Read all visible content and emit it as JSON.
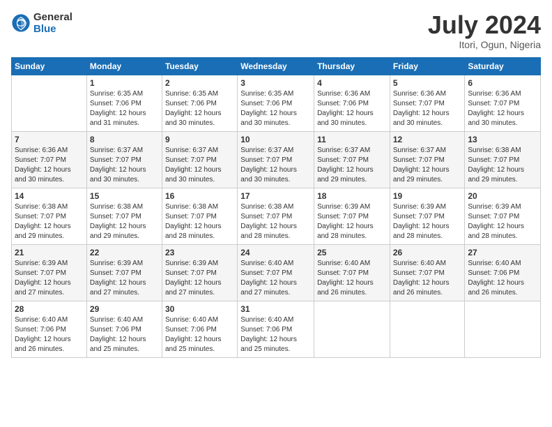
{
  "header": {
    "logo_general": "General",
    "logo_blue": "Blue",
    "month_title": "July 2024",
    "location": "Itori, Ogun, Nigeria"
  },
  "weekdays": [
    "Sunday",
    "Monday",
    "Tuesday",
    "Wednesday",
    "Thursday",
    "Friday",
    "Saturday"
  ],
  "weeks": [
    [
      {
        "day": "",
        "info": ""
      },
      {
        "day": "1",
        "info": "Sunrise: 6:35 AM\nSunset: 7:06 PM\nDaylight: 12 hours\nand 31 minutes."
      },
      {
        "day": "2",
        "info": "Sunrise: 6:35 AM\nSunset: 7:06 PM\nDaylight: 12 hours\nand 30 minutes."
      },
      {
        "day": "3",
        "info": "Sunrise: 6:35 AM\nSunset: 7:06 PM\nDaylight: 12 hours\nand 30 minutes."
      },
      {
        "day": "4",
        "info": "Sunrise: 6:36 AM\nSunset: 7:06 PM\nDaylight: 12 hours\nand 30 minutes."
      },
      {
        "day": "5",
        "info": "Sunrise: 6:36 AM\nSunset: 7:07 PM\nDaylight: 12 hours\nand 30 minutes."
      },
      {
        "day": "6",
        "info": "Sunrise: 6:36 AM\nSunset: 7:07 PM\nDaylight: 12 hours\nand 30 minutes."
      }
    ],
    [
      {
        "day": "7",
        "info": "Sunrise: 6:36 AM\nSunset: 7:07 PM\nDaylight: 12 hours\nand 30 minutes."
      },
      {
        "day": "8",
        "info": "Sunrise: 6:37 AM\nSunset: 7:07 PM\nDaylight: 12 hours\nand 30 minutes."
      },
      {
        "day": "9",
        "info": "Sunrise: 6:37 AM\nSunset: 7:07 PM\nDaylight: 12 hours\nand 30 minutes."
      },
      {
        "day": "10",
        "info": "Sunrise: 6:37 AM\nSunset: 7:07 PM\nDaylight: 12 hours\nand 30 minutes."
      },
      {
        "day": "11",
        "info": "Sunrise: 6:37 AM\nSunset: 7:07 PM\nDaylight: 12 hours\nand 29 minutes."
      },
      {
        "day": "12",
        "info": "Sunrise: 6:37 AM\nSunset: 7:07 PM\nDaylight: 12 hours\nand 29 minutes."
      },
      {
        "day": "13",
        "info": "Sunrise: 6:38 AM\nSunset: 7:07 PM\nDaylight: 12 hours\nand 29 minutes."
      }
    ],
    [
      {
        "day": "14",
        "info": "Sunrise: 6:38 AM\nSunset: 7:07 PM\nDaylight: 12 hours\nand 29 minutes."
      },
      {
        "day": "15",
        "info": "Sunrise: 6:38 AM\nSunset: 7:07 PM\nDaylight: 12 hours\nand 29 minutes."
      },
      {
        "day": "16",
        "info": "Sunrise: 6:38 AM\nSunset: 7:07 PM\nDaylight: 12 hours\nand 28 minutes."
      },
      {
        "day": "17",
        "info": "Sunrise: 6:38 AM\nSunset: 7:07 PM\nDaylight: 12 hours\nand 28 minutes."
      },
      {
        "day": "18",
        "info": "Sunrise: 6:39 AM\nSunset: 7:07 PM\nDaylight: 12 hours\nand 28 minutes."
      },
      {
        "day": "19",
        "info": "Sunrise: 6:39 AM\nSunset: 7:07 PM\nDaylight: 12 hours\nand 28 minutes."
      },
      {
        "day": "20",
        "info": "Sunrise: 6:39 AM\nSunset: 7:07 PM\nDaylight: 12 hours\nand 28 minutes."
      }
    ],
    [
      {
        "day": "21",
        "info": "Sunrise: 6:39 AM\nSunset: 7:07 PM\nDaylight: 12 hours\nand 27 minutes."
      },
      {
        "day": "22",
        "info": "Sunrise: 6:39 AM\nSunset: 7:07 PM\nDaylight: 12 hours\nand 27 minutes."
      },
      {
        "day": "23",
        "info": "Sunrise: 6:39 AM\nSunset: 7:07 PM\nDaylight: 12 hours\nand 27 minutes."
      },
      {
        "day": "24",
        "info": "Sunrise: 6:40 AM\nSunset: 7:07 PM\nDaylight: 12 hours\nand 27 minutes."
      },
      {
        "day": "25",
        "info": "Sunrise: 6:40 AM\nSunset: 7:07 PM\nDaylight: 12 hours\nand 26 minutes."
      },
      {
        "day": "26",
        "info": "Sunrise: 6:40 AM\nSunset: 7:07 PM\nDaylight: 12 hours\nand 26 minutes."
      },
      {
        "day": "27",
        "info": "Sunrise: 6:40 AM\nSunset: 7:06 PM\nDaylight: 12 hours\nand 26 minutes."
      }
    ],
    [
      {
        "day": "28",
        "info": "Sunrise: 6:40 AM\nSunset: 7:06 PM\nDaylight: 12 hours\nand 26 minutes."
      },
      {
        "day": "29",
        "info": "Sunrise: 6:40 AM\nSunset: 7:06 PM\nDaylight: 12 hours\nand 25 minutes."
      },
      {
        "day": "30",
        "info": "Sunrise: 6:40 AM\nSunset: 7:06 PM\nDaylight: 12 hours\nand 25 minutes."
      },
      {
        "day": "31",
        "info": "Sunrise: 6:40 AM\nSunset: 7:06 PM\nDaylight: 12 hours\nand 25 minutes."
      },
      {
        "day": "",
        "info": ""
      },
      {
        "day": "",
        "info": ""
      },
      {
        "day": "",
        "info": ""
      }
    ]
  ]
}
